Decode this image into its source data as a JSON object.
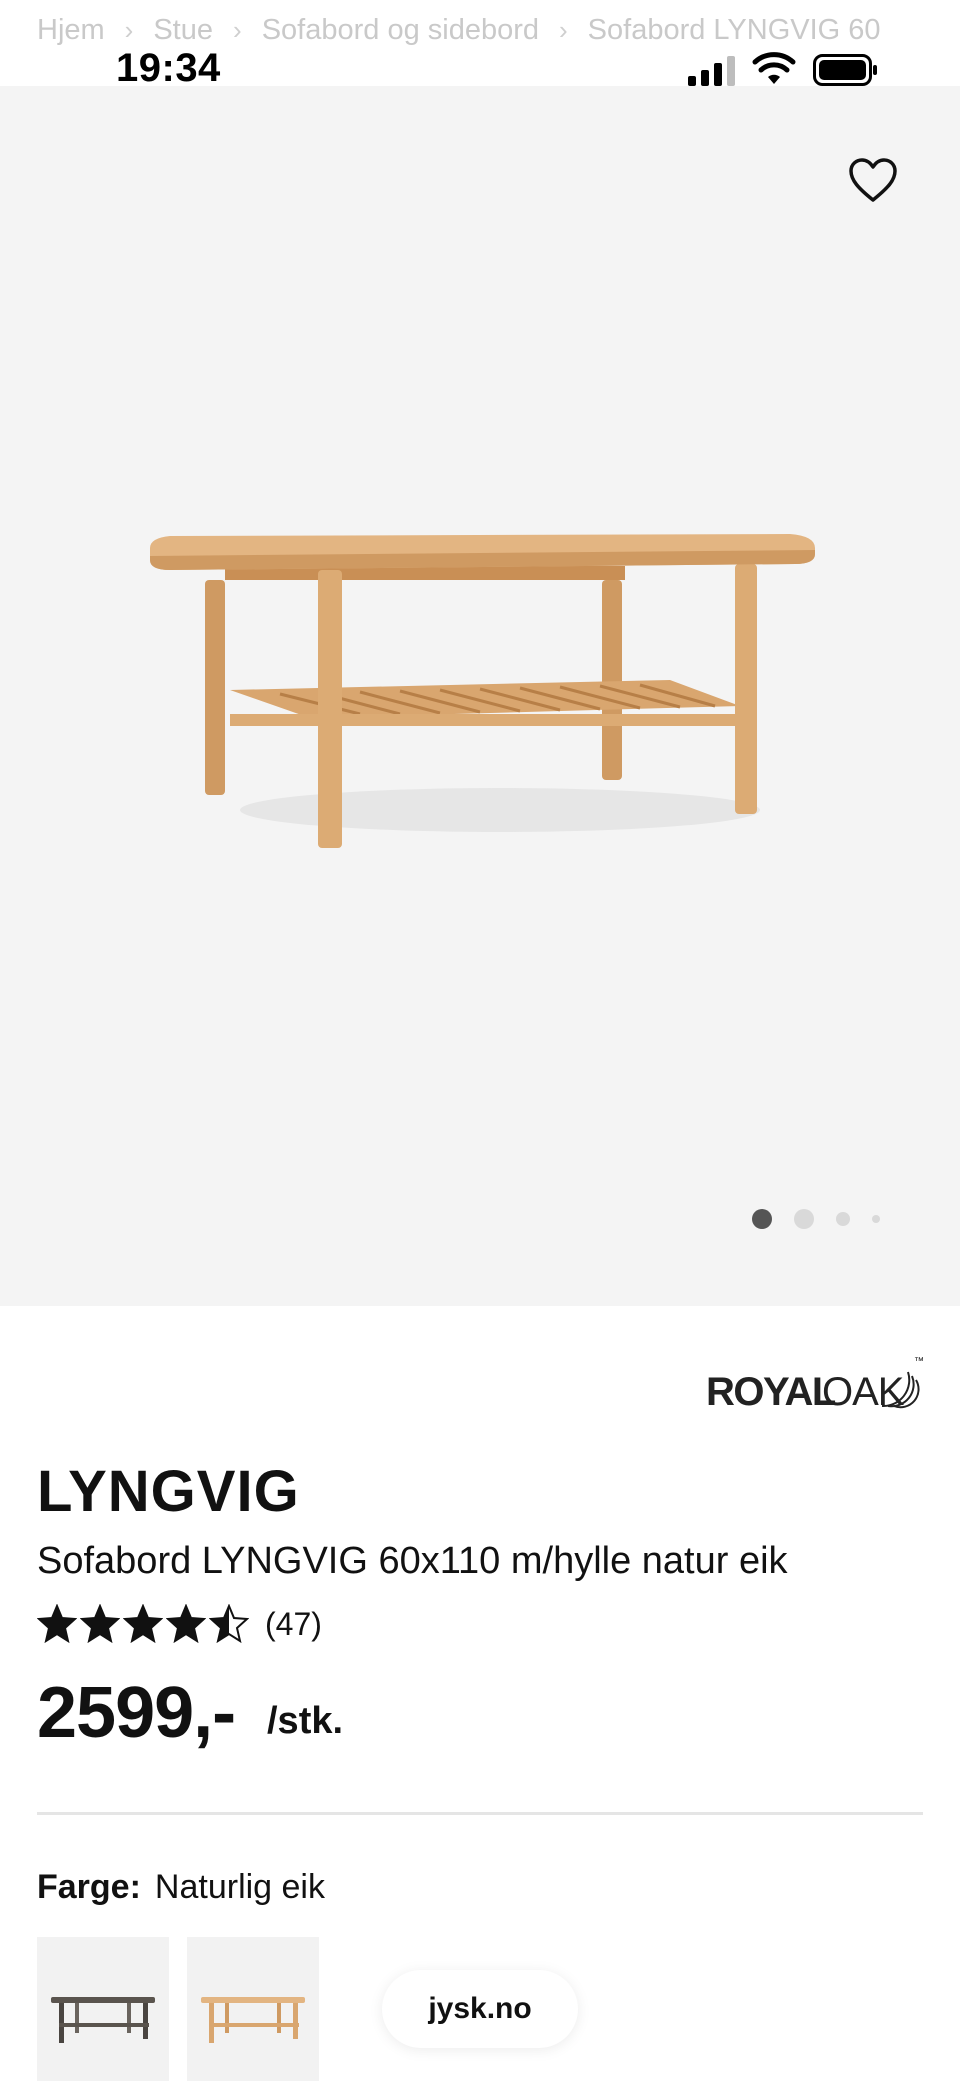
{
  "breadcrumb": {
    "items": [
      "Hjem",
      "Stue",
      "Sofabord og sidebord",
      "Sofabord LYNGVIG 60"
    ],
    "separator": "›"
  },
  "status_bar": {
    "time": "19:34",
    "icons": [
      "cellular-signal-icon",
      "wifi-icon",
      "battery-icon"
    ]
  },
  "gallery": {
    "image_alt": "Sofabord LYNGVIG",
    "favorite_icon": "heart-outline-icon",
    "page_dots": 4,
    "active_dot": 0
  },
  "brand": {
    "logo_part1": "ROYAL",
    "logo_part2": "OAK",
    "trademark": "™"
  },
  "product": {
    "name": "LYNGVIG",
    "description": "Sofabord LYNGVIG 60x110 m/hylle natur eik",
    "rating_value": 4.5,
    "rating_max": 5,
    "review_count": "(47)",
    "price": "2599,-",
    "unit": "/stk."
  },
  "color_selector": {
    "label": "Farge:",
    "value": "Naturlig eik",
    "swatches": [
      "dark-table-variant",
      "natural-oak-variant"
    ]
  },
  "site_pill": {
    "label": "jysk.no"
  },
  "colors": {
    "hero_bg": "#f4f4f4",
    "oak": "#d9a872",
    "text": "#111111",
    "breadcrumb": "#c9c9c9"
  }
}
